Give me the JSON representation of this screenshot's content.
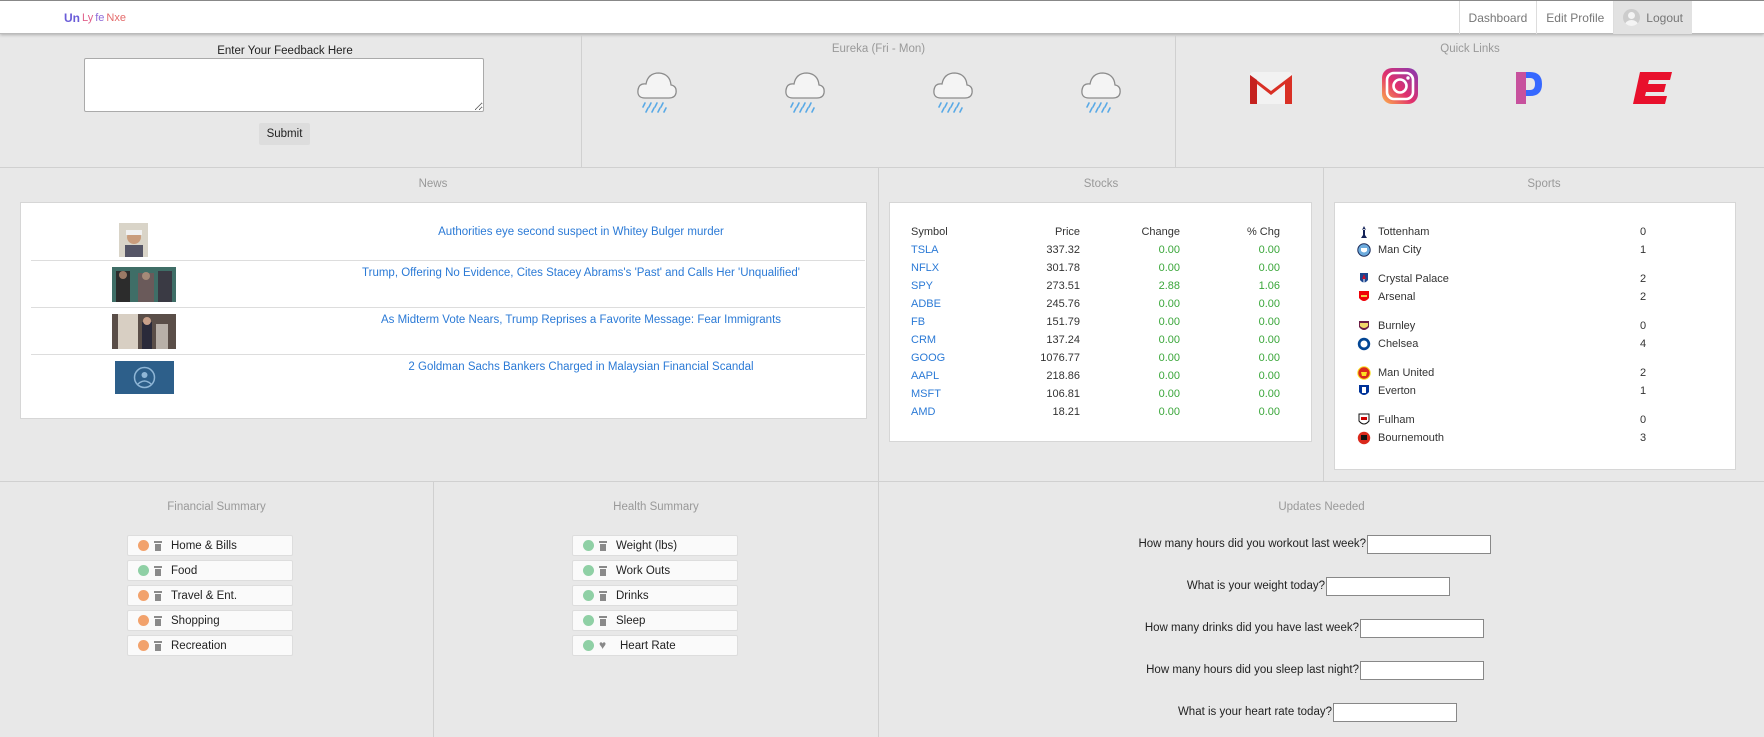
{
  "nav": {
    "logo_mark": "Un",
    "logo_text_1": "Ly",
    "logo_text_2": "fe",
    "logo_text_3": "Nxe",
    "links": [
      "Dashboard",
      "Edit Profile",
      "Logout"
    ]
  },
  "feedback": {
    "label": "Enter Your Feedback Here",
    "value": "",
    "submit": "Submit"
  },
  "weather": {
    "title": "Eureka (Fri - Mon)",
    "days": [
      {
        "icon": "rain-cloud-icon"
      },
      {
        "icon": "rain-cloud-icon"
      },
      {
        "icon": "rain-cloud-icon"
      },
      {
        "icon": "rain-cloud-icon"
      }
    ]
  },
  "quick_links": {
    "title": "Quick Links",
    "items": [
      {
        "icon": "gmail-icon",
        "color": "#d93025"
      },
      {
        "icon": "instagram-icon",
        "color": "#c13584"
      },
      {
        "icon": "pandora-icon",
        "color": "#3668ff"
      },
      {
        "icon": "espn-icon",
        "color": "#e8102c"
      }
    ]
  },
  "news": {
    "title": "News",
    "items": [
      {
        "headline": "Authorities eye second suspect in Whitey Bulger murder"
      },
      {
        "headline": "Trump, Offering No Evidence, Cites Stacey Abrams's 'Past' and Calls Her 'Unqualified'"
      },
      {
        "headline": "As Midterm Vote Nears, Trump Reprises a Favorite Message: Fear Immigrants"
      },
      {
        "headline": "2 Goldman Sachs Bankers Charged in Malaysian Financial Scandal"
      }
    ]
  },
  "stocks": {
    "title": "Stocks",
    "headers": [
      "Symbol",
      "Price",
      "Change",
      "% Chg"
    ],
    "rows": [
      {
        "symbol": "TSLA",
        "price": "337.32",
        "change": "0.00",
        "pct": "0.00"
      },
      {
        "symbol": "NFLX",
        "price": "301.78",
        "change": "0.00",
        "pct": "0.00"
      },
      {
        "symbol": "SPY",
        "price": "273.51",
        "change": "2.88",
        "pct": "1.06"
      },
      {
        "symbol": "ADBE",
        "price": "245.76",
        "change": "0.00",
        "pct": "0.00"
      },
      {
        "symbol": "FB",
        "price": "151.79",
        "change": "0.00",
        "pct": "0.00"
      },
      {
        "symbol": "CRM",
        "price": "137.24",
        "change": "0.00",
        "pct": "0.00"
      },
      {
        "symbol": "GOOG",
        "price": "1076.77",
        "change": "0.00",
        "pct": "0.00"
      },
      {
        "symbol": "AAPL",
        "price": "218.86",
        "change": "0.00",
        "pct": "0.00"
      },
      {
        "symbol": "MSFT",
        "price": "106.81",
        "change": "0.00",
        "pct": "0.00"
      },
      {
        "symbol": "AMD",
        "price": "18.21",
        "change": "0.00",
        "pct": "0.00"
      }
    ],
    "up_color": "#3aa63a"
  },
  "sports": {
    "title": "Sports",
    "matches": [
      {
        "home": "Tottenham",
        "home_score": "0",
        "away": "Man City",
        "away_score": "1"
      },
      {
        "home": "Crystal Palace",
        "home_score": "2",
        "away": "Arsenal",
        "away_score": "2"
      },
      {
        "home": "Burnley",
        "home_score": "0",
        "away": "Chelsea",
        "away_score": "4"
      },
      {
        "home": "Man United",
        "home_score": "2",
        "away": "Everton",
        "away_score": "1"
      },
      {
        "home": "Fulham",
        "home_score": "0",
        "away": "Bournemouth",
        "away_score": "3"
      }
    ]
  },
  "financial": {
    "title": "Financial Summary",
    "items": [
      "Home & Bills",
      "Food",
      "Travel & Ent.",
      "Shopping",
      "Recreation"
    ],
    "status": [
      "orange",
      "green",
      "orange",
      "orange",
      "orange"
    ]
  },
  "health": {
    "title": "Health Summary",
    "items": [
      "Weight (lbs)",
      "Work Outs",
      "Drinks",
      "Sleep",
      "Heart Rate"
    ],
    "status": [
      "green",
      "green",
      "green",
      "green",
      "green"
    ]
  },
  "updates": {
    "title": "Updates Needed",
    "questions": [
      {
        "label": "How many hours did you workout last week?",
        "value": ""
      },
      {
        "label": "What is your weight today?",
        "value": ""
      },
      {
        "label": "How many drinks did you have last week?",
        "value": ""
      },
      {
        "label": "How many hours did you sleep last night?",
        "value": ""
      },
      {
        "label": "What is your heart rate today?",
        "value": ""
      }
    ]
  }
}
